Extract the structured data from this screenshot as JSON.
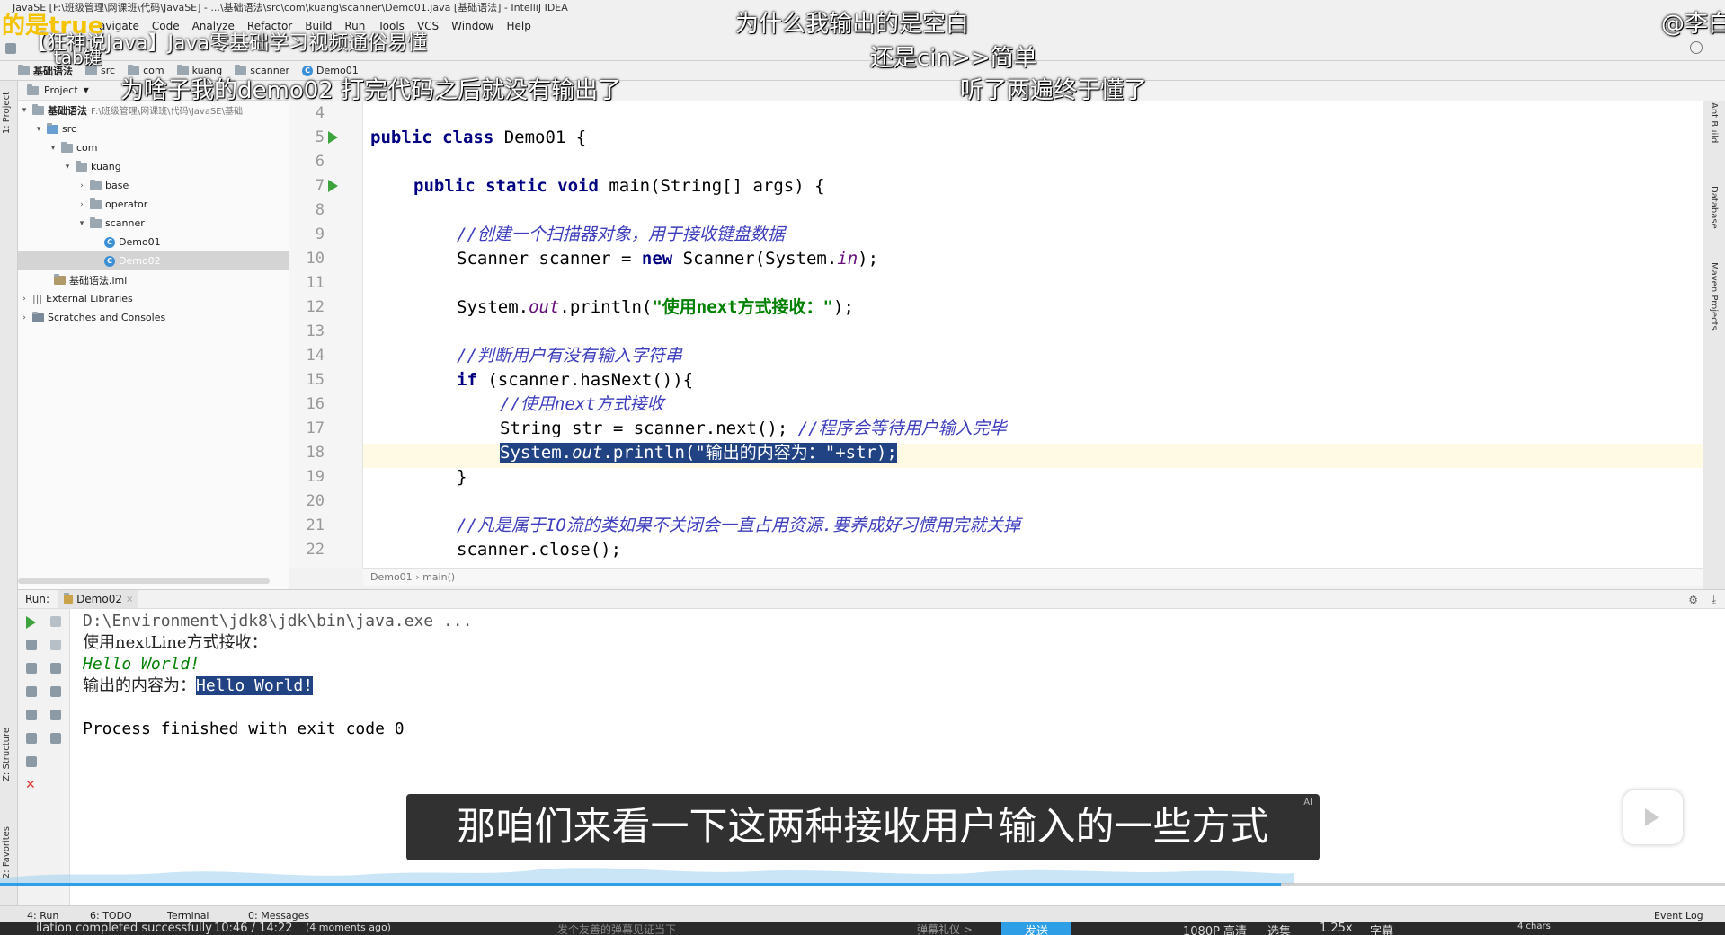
{
  "window": {
    "title": "JavaSE [F:\\班级管理\\网课班\\代码\\JavaSE] - ...\\基础语法\\src\\com\\kuang\\scanner\\Demo01.java [基础语法] - IntelliJ IDEA"
  },
  "menu": [
    "avigate",
    "Code",
    "Analyze",
    "Refactor",
    "Build",
    "Run",
    "Tools",
    "VCS",
    "Window",
    "Help"
  ],
  "breadcrumb": [
    "基础语法",
    "src",
    "com",
    "kuang",
    "scanner",
    "Demo01"
  ],
  "project": {
    "header": "Project",
    "root_name": "基础语法",
    "root_path": "F:\\班级管理\\网课班\\代码\\JavaSE\\基础",
    "items": {
      "src": "src",
      "com": "com",
      "kuang": "kuang",
      "base": "base",
      "operator": "operator",
      "scanner": "scanner",
      "demo01": "Demo01",
      "demo02": "Demo02",
      "iml": "基础语法.iml",
      "ext": "External Libraries",
      "scratches": "Scratches and Consoles"
    }
  },
  "side_labels": {
    "project": "1: Project",
    "structure": "Z: Structure",
    "favorites": "2: Favorites",
    "ant": "Ant Build",
    "database": "Database",
    "maven": "Maven Projects"
  },
  "editor": {
    "line_numbers": [
      "4",
      "5",
      "6",
      "7",
      "8",
      "9",
      "10",
      "11",
      "12",
      "13",
      "14",
      "15",
      "16",
      "17",
      "18",
      "19",
      "20",
      "21",
      "22"
    ],
    "lines": {
      "l5_kw": "public class ",
      "l5_rest": "Demo01 {",
      "l7_kw": "public static void ",
      "l7_rest": "main(String[] args) {",
      "l9": "//创建一个扫描器对象，用于接收键盘数据",
      "l10_a": "Scanner scanner = ",
      "l10_kw": "new ",
      "l10_b": "Scanner(System.",
      "l10_it": "in",
      "l10_c": ");",
      "l12_a": "System.",
      "l12_it": "out",
      "l12_b": ".println(",
      "l12_st": "\"使用next方式接收：\"",
      "l12_c": ");",
      "l14": "//判断用户有没有输入字符串",
      "l15_kw": "if ",
      "l15_rest": "(scanner.hasNext()){",
      "l16": "//使用next方式接收",
      "l17_a": "String str = scanner.next(); ",
      "l17_cm": "//程序会等待用户输入完毕",
      "l18_a": "System.",
      "l18_it": "out",
      "l18_b": ".println(\"输出的内容为：\"+str);",
      "l19": "}",
      "l21": "//凡是属于IO流的类如果不关闭会一直占用资源.要养成好习惯用完就关掉",
      "l22": "scanner.close();"
    },
    "breadcrumb": [
      "Demo01",
      "main()"
    ]
  },
  "run": {
    "label": "Run:",
    "tab": "Demo02",
    "console": {
      "cmd": "D:\\Environment\\jdk8\\jdk\\bin\\java.exe ...",
      "prompt": "使用nextLine方式接收：",
      "input": "Hello World!",
      "out_label": "输出的内容为：",
      "out_value": "Hello World!",
      "exit": "Process finished with exit code 0"
    }
  },
  "bottom_tabs": [
    "4: Run",
    "6: TODO",
    "Terminal",
    "0: Messages"
  ],
  "bottom_right": "Event Log",
  "overlay": {
    "video_title": "【狂神说Java】Java零基础学习视频通俗易懂",
    "corner_top_left": "的是true",
    "corner_tab": "tab键",
    "danmaku": [
      "为什么我输出的是空白",
      "还是cin>>简单",
      "为啥子我的demo02 打完代码之后就没有输出了",
      "听了两遍终于懂了",
      "@李白"
    ],
    "subtitle": "那咱们来看一下这两种接收用户输入的一些方式",
    "ai_badge": "AI"
  },
  "player": {
    "time": "10:46 / 14:22",
    "status_left": "ilation completed successfully",
    "status_mid": "(4 moments ago)",
    "danmaku_placeholder": "发个友善的弹幕见证当下",
    "etiquette": "弹幕礼仪 >",
    "send": "发送",
    "quality": "1080P 高清",
    "episodes": "选集",
    "speed": "1.25x",
    "subs": "字幕",
    "chars": "4 chars"
  },
  "colors": {
    "accent": "#2e9fe6",
    "keyword": "#000080",
    "comment": "#3d3dbd",
    "string": "#008000",
    "selection": "#214283",
    "send_button": "#2e9fe6"
  }
}
